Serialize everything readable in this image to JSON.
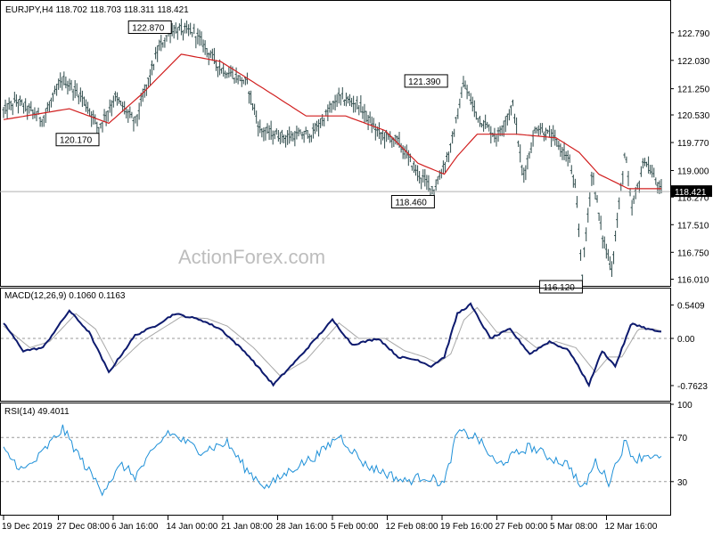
{
  "chart_data": [
    {
      "type": "ohlc",
      "header": "EURJPY,H4  118.702 118.703 118.311 118.421",
      "last_price": "118.421",
      "last_value": 118.421,
      "ylim": [
        115.9,
        123.25
      ],
      "y_ticks": [
        "122.790",
        "122.030",
        "121.250",
        "120.530",
        "119.770",
        "119.000",
        "118.270",
        "117.510",
        "116.750",
        "116.010"
      ],
      "x_ticks": [
        "19 Dec 2019",
        "27 Dec 08:00",
        "6 Jan 16:00",
        "14 Jan 00:00",
        "21 Jan 08:00",
        "28 Jan 16:00",
        "5 Feb 00:00",
        "12 Feb 08:00",
        "19 Feb 16:00",
        "27 Feb 00:00",
        "5 Mar 08:00",
        "12 Mar 16:00"
      ],
      "watermark": "ActionForex.com",
      "annotations": [
        {
          "text": "122.870",
          "t": 0.255,
          "value": 122.87
        },
        {
          "text": "120.170",
          "t": 0.145,
          "value": 120.17
        },
        {
          "text": "121.390",
          "t": 0.675,
          "value": 121.39
        },
        {
          "text": "118.460",
          "t": 0.655,
          "value": 118.46
        },
        {
          "text": "116.120",
          "t": 0.88,
          "value": 116.12
        }
      ],
      "price_keys": [
        [
          0.0,
          120.6
        ],
        [
          0.02,
          120.9
        ],
        [
          0.06,
          120.4
        ],
        [
          0.09,
          121.5
        ],
        [
          0.12,
          121.0
        ],
        [
          0.145,
          120.17
        ],
        [
          0.17,
          121.0
        ],
        [
          0.2,
          120.3
        ],
        [
          0.235,
          122.3
        ],
        [
          0.255,
          122.87
        ],
        [
          0.29,
          122.8
        ],
        [
          0.33,
          121.8
        ],
        [
          0.37,
          121.4
        ],
        [
          0.39,
          120.1
        ],
        [
          0.43,
          119.9
        ],
        [
          0.47,
          120.0
        ],
        [
          0.51,
          121.0
        ],
        [
          0.54,
          120.8
        ],
        [
          0.57,
          120.0
        ],
        [
          0.6,
          119.8
        ],
        [
          0.63,
          118.9
        ],
        [
          0.655,
          118.46
        ],
        [
          0.68,
          119.6
        ],
        [
          0.7,
          121.39
        ],
        [
          0.72,
          120.5
        ],
        [
          0.75,
          119.9
        ],
        [
          0.775,
          120.8
        ],
        [
          0.79,
          118.8
        ],
        [
          0.81,
          120.2
        ],
        [
          0.835,
          119.9
        ],
        [
          0.86,
          119.3
        ],
        [
          0.87,
          118.4
        ],
        [
          0.88,
          116.12
        ],
        [
          0.895,
          119.0
        ],
        [
          0.91,
          117.2
        ],
        [
          0.925,
          116.3
        ],
        [
          0.945,
          119.5
        ],
        [
          0.955,
          117.9
        ],
        [
          0.975,
          119.3
        ],
        [
          1.0,
          118.42
        ]
      ],
      "ma_keys": [
        [
          0.0,
          120.4
        ],
        [
          0.1,
          120.7
        ],
        [
          0.16,
          120.3
        ],
        [
          0.21,
          121.1
        ],
        [
          0.27,
          122.2
        ],
        [
          0.33,
          122.0
        ],
        [
          0.4,
          121.2
        ],
        [
          0.46,
          120.5
        ],
        [
          0.52,
          120.5
        ],
        [
          0.58,
          120.1
        ],
        [
          0.63,
          119.2
        ],
        [
          0.67,
          118.9
        ],
        [
          0.69,
          119.4
        ],
        [
          0.72,
          120.0
        ],
        [
          0.78,
          120.0
        ],
        [
          0.84,
          119.9
        ],
        [
          0.875,
          119.5
        ],
        [
          0.905,
          118.9
        ],
        [
          0.95,
          118.5
        ],
        [
          1.0,
          118.5
        ]
      ]
    },
    {
      "type": "line",
      "header": "MACD(12,26,9) 0.1060 0.1163",
      "y_ticks": [
        "0.5409",
        "0.00",
        "-0.7623"
      ],
      "ylim": [
        -0.95,
        0.72
      ],
      "zero_level": 0,
      "macd_keys": [
        [
          0.0,
          0.25
        ],
        [
          0.03,
          -0.2
        ],
        [
          0.06,
          -0.15
        ],
        [
          0.1,
          0.45
        ],
        [
          0.13,
          0.1
        ],
        [
          0.16,
          -0.55
        ],
        [
          0.2,
          0.05
        ],
        [
          0.23,
          0.2
        ],
        [
          0.26,
          0.4
        ],
        [
          0.3,
          0.3
        ],
        [
          0.33,
          0.15
        ],
        [
          0.37,
          -0.25
        ],
        [
          0.41,
          -0.75
        ],
        [
          0.45,
          -0.3
        ],
        [
          0.5,
          0.3
        ],
        [
          0.53,
          -0.1
        ],
        [
          0.57,
          0.0
        ],
        [
          0.6,
          -0.3
        ],
        [
          0.63,
          -0.35
        ],
        [
          0.65,
          -0.45
        ],
        [
          0.67,
          -0.3
        ],
        [
          0.69,
          0.4
        ],
        [
          0.71,
          0.55
        ],
        [
          0.74,
          0.0
        ],
        [
          0.77,
          0.15
        ],
        [
          0.8,
          -0.25
        ],
        [
          0.83,
          -0.05
        ],
        [
          0.86,
          -0.2
        ],
        [
          0.89,
          -0.75
        ],
        [
          0.91,
          -0.2
        ],
        [
          0.93,
          -0.45
        ],
        [
          0.955,
          0.25
        ],
        [
          0.98,
          0.15
        ],
        [
          1.0,
          0.1
        ]
      ],
      "signal_keys": [
        [
          0.0,
          0.2
        ],
        [
          0.04,
          -0.15
        ],
        [
          0.07,
          -0.05
        ],
        [
          0.11,
          0.4
        ],
        [
          0.14,
          0.15
        ],
        [
          0.17,
          -0.45
        ],
        [
          0.21,
          -0.05
        ],
        [
          0.24,
          0.15
        ],
        [
          0.27,
          0.35
        ],
        [
          0.31,
          0.32
        ],
        [
          0.34,
          0.2
        ],
        [
          0.38,
          -0.15
        ],
        [
          0.42,
          -0.6
        ],
        [
          0.46,
          -0.35
        ],
        [
          0.51,
          0.25
        ],
        [
          0.54,
          0.0
        ],
        [
          0.58,
          0.0
        ],
        [
          0.61,
          -0.2
        ],
        [
          0.64,
          -0.3
        ],
        [
          0.66,
          -0.4
        ],
        [
          0.68,
          -0.25
        ],
        [
          0.7,
          0.3
        ],
        [
          0.72,
          0.5
        ],
        [
          0.75,
          0.1
        ],
        [
          0.78,
          0.1
        ],
        [
          0.81,
          -0.15
        ],
        [
          0.84,
          -0.05
        ],
        [
          0.87,
          -0.15
        ],
        [
          0.9,
          -0.55
        ],
        [
          0.92,
          -0.3
        ],
        [
          0.94,
          -0.3
        ],
        [
          0.965,
          0.15
        ],
        [
          0.99,
          0.15
        ],
        [
          1.0,
          0.12
        ]
      ]
    },
    {
      "type": "line",
      "header": "RSI(14) 49.4011",
      "y_ticks": [
        "100",
        "70",
        "30"
      ],
      "ylim": [
        0,
        100
      ],
      "levels": [
        70,
        30
      ],
      "rsi_keys": [
        [
          0.0,
          58
        ],
        [
          0.03,
          40
        ],
        [
          0.05,
          50
        ],
        [
          0.09,
          78
        ],
        [
          0.12,
          48
        ],
        [
          0.15,
          22
        ],
        [
          0.18,
          45
        ],
        [
          0.2,
          35
        ],
        [
          0.25,
          75
        ],
        [
          0.27,
          68
        ],
        [
          0.3,
          58
        ],
        [
          0.34,
          65
        ],
        [
          0.37,
          40
        ],
        [
          0.4,
          25
        ],
        [
          0.44,
          42
        ],
        [
          0.48,
          55
        ],
        [
          0.51,
          72
        ],
        [
          0.55,
          45
        ],
        [
          0.58,
          38
        ],
        [
          0.61,
          30
        ],
        [
          0.64,
          35
        ],
        [
          0.67,
          28
        ],
        [
          0.69,
          75
        ],
        [
          0.72,
          70
        ],
        [
          0.75,
          45
        ],
        [
          0.78,
          55
        ],
        [
          0.8,
          62
        ],
        [
          0.83,
          52
        ],
        [
          0.86,
          45
        ],
        [
          0.88,
          22
        ],
        [
          0.9,
          48
        ],
        [
          0.92,
          30
        ],
        [
          0.945,
          66
        ],
        [
          0.96,
          50
        ],
        [
          0.98,
          55
        ],
        [
          1.0,
          49
        ]
      ]
    }
  ]
}
